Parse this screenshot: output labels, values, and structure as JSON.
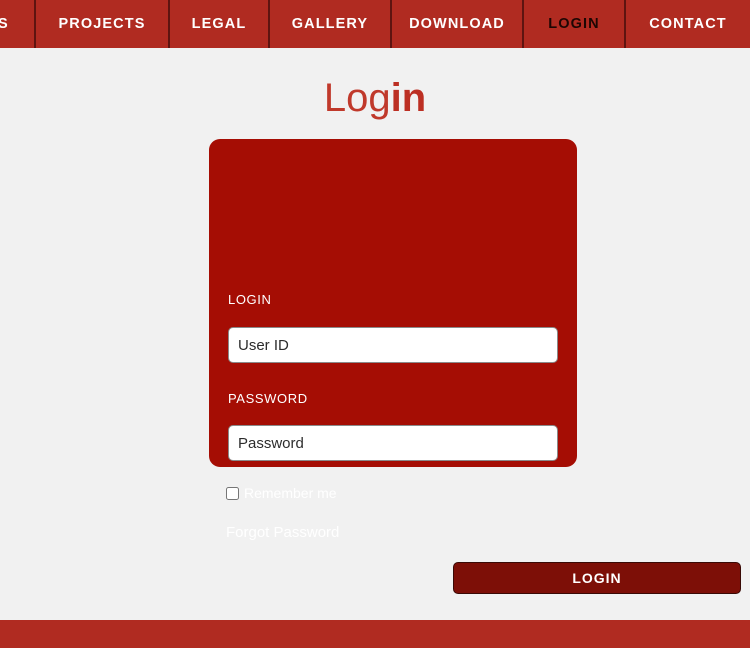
{
  "nav": {
    "items": [
      {
        "label": "S",
        "clipped": true,
        "active": false
      },
      {
        "label": "PROJECTS",
        "clipped": false,
        "active": false
      },
      {
        "label": "LEGAL",
        "clipped": false,
        "active": false
      },
      {
        "label": "GALLERY",
        "clipped": false,
        "active": false
      },
      {
        "label": "DOWNLOAD",
        "clipped": false,
        "active": false
      },
      {
        "label": "LOGIN",
        "clipped": false,
        "active": true
      },
      {
        "label": "CONTACT",
        "clipped": false,
        "active": false
      }
    ],
    "background_color": "#b02b21",
    "divider_color": "#5e1410",
    "text_color": "#ffffff",
    "active_text_color": "#1d0603"
  },
  "heading": {
    "text_normal": "Log",
    "text_bold": "in",
    "color": "#c0392b"
  },
  "card": {
    "background_color": "#a50d04",
    "login_label": "LOGIN",
    "password_label": "PASSWORD",
    "user_input": {
      "value": "",
      "placeholder": "User ID"
    },
    "password_input": {
      "value": "",
      "placeholder": "Password"
    },
    "remember_me": {
      "label": "Remember me",
      "checked": false
    },
    "forgot_password_label": "Forgot Password",
    "submit_label": "LOGIN",
    "submit_color": "#7d0f07"
  },
  "footer": {
    "background_color": "#b02b21"
  },
  "page": {
    "background_color": "#f1f1f1"
  }
}
